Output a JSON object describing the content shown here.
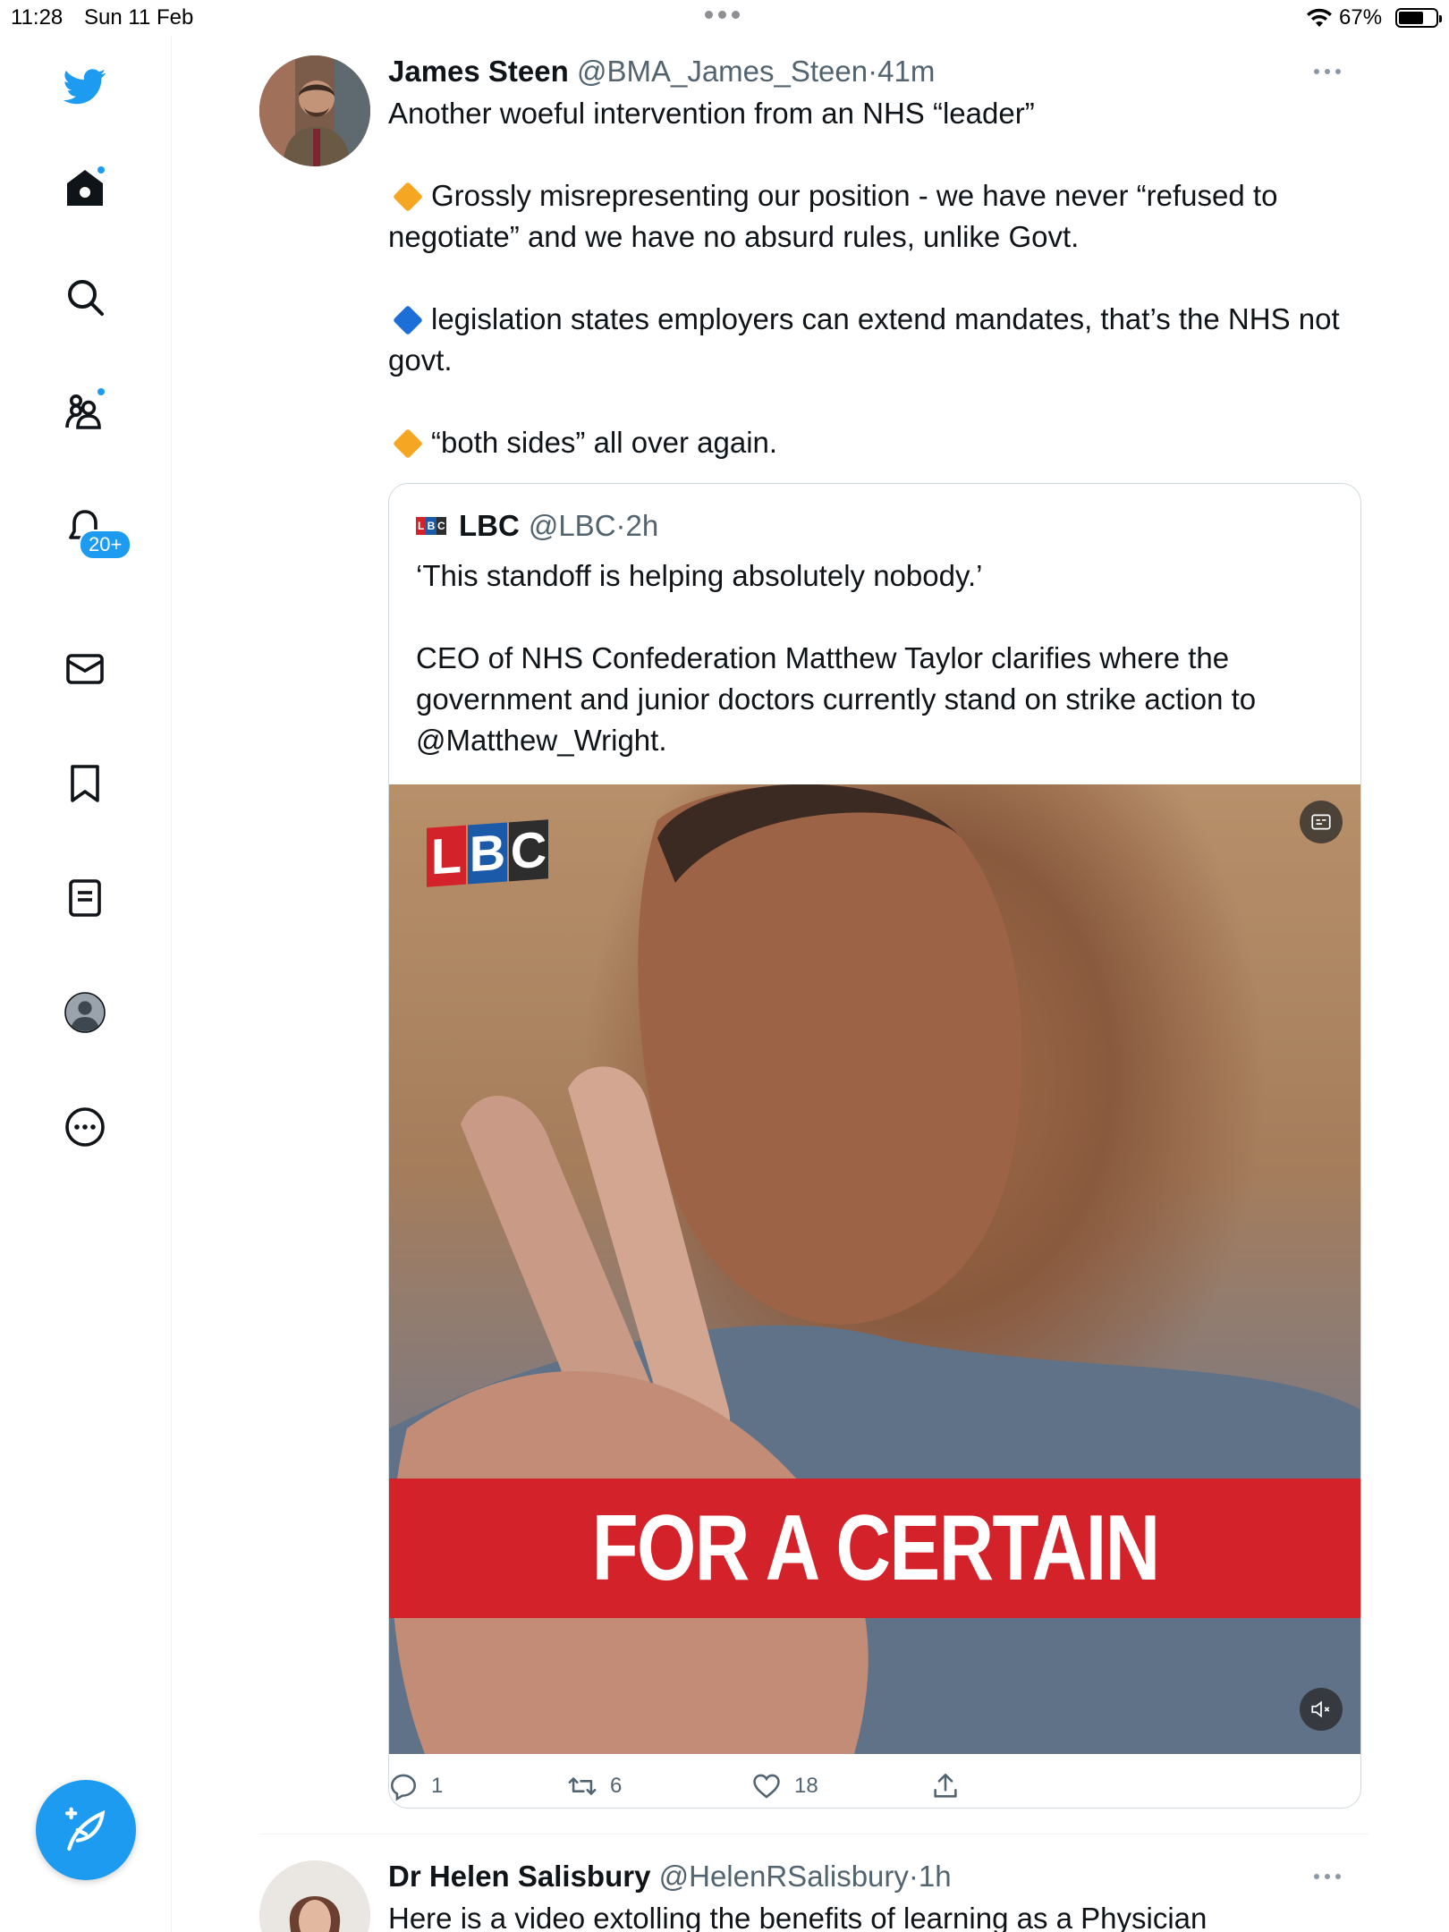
{
  "status_bar": {
    "time": "11:28",
    "date": "Sun 11 Feb",
    "battery_pct": "67%",
    "battery_level": 0.67
  },
  "sidebar": {
    "items": [
      {
        "name": "logo",
        "icon": "twitter-bird-icon"
      },
      {
        "name": "home",
        "icon": "home-icon",
        "has_dot": true
      },
      {
        "name": "explore",
        "icon": "search-icon"
      },
      {
        "name": "communities",
        "icon": "communities-icon",
        "has_dot": true
      },
      {
        "name": "notifications",
        "icon": "bell-icon",
        "badge": "20+"
      },
      {
        "name": "messages",
        "icon": "mail-icon"
      },
      {
        "name": "bookmarks",
        "icon": "bookmark-icon"
      },
      {
        "name": "lists",
        "icon": "list-icon"
      },
      {
        "name": "profile",
        "icon": "profile-icon"
      },
      {
        "name": "more",
        "icon": "more-circle-icon"
      }
    ],
    "notifications_badge": "20+",
    "compose_icon": "compose-feather-icon"
  },
  "tweet": {
    "author_name": "James Steen",
    "handle": "@BMA_James_Steen",
    "separator": "·",
    "time": "41m",
    "lines": [
      "Another woeful intervention from an NHS “leader”",
      "Grossly misrepresenting our position - we have never “refused to negotiate” and we have no absurd rules, unlike Govt.",
      "legislation states employers can extend mandates, that’s the NHS not govt.",
      "“both sides” all over again."
    ],
    "bullet_colors": [
      "#f5a623",
      "#1d6fd8",
      "#f5a623"
    ],
    "quoted": {
      "author_name": "LBC",
      "handle": "@LBC",
      "separator": "·",
      "time": "2h",
      "text_1": "‘This standoff is helping absolutely nobody.’",
      "text_2": "CEO of NHS Confederation Matthew Taylor clarifies where the government and junior doctors currently stand on strike action to @Matthew_Wright.",
      "video": {
        "logo_letters": [
          "L",
          "B",
          "C"
        ],
        "logo_colors": [
          "#d3222a",
          "#1a5aa8",
          "#2d2d2d"
        ],
        "caption": "FOR A CERTAIN"
      }
    },
    "actions": {
      "replies": "1",
      "retweets": "6",
      "likes": "18"
    }
  },
  "next_tweet": {
    "author_name": "Dr Helen Salisbury",
    "handle": "@HelenRSalisbury",
    "separator": "·",
    "time": "1h",
    "text": "Here is a video extolling the benefits of learning as a Physician"
  }
}
